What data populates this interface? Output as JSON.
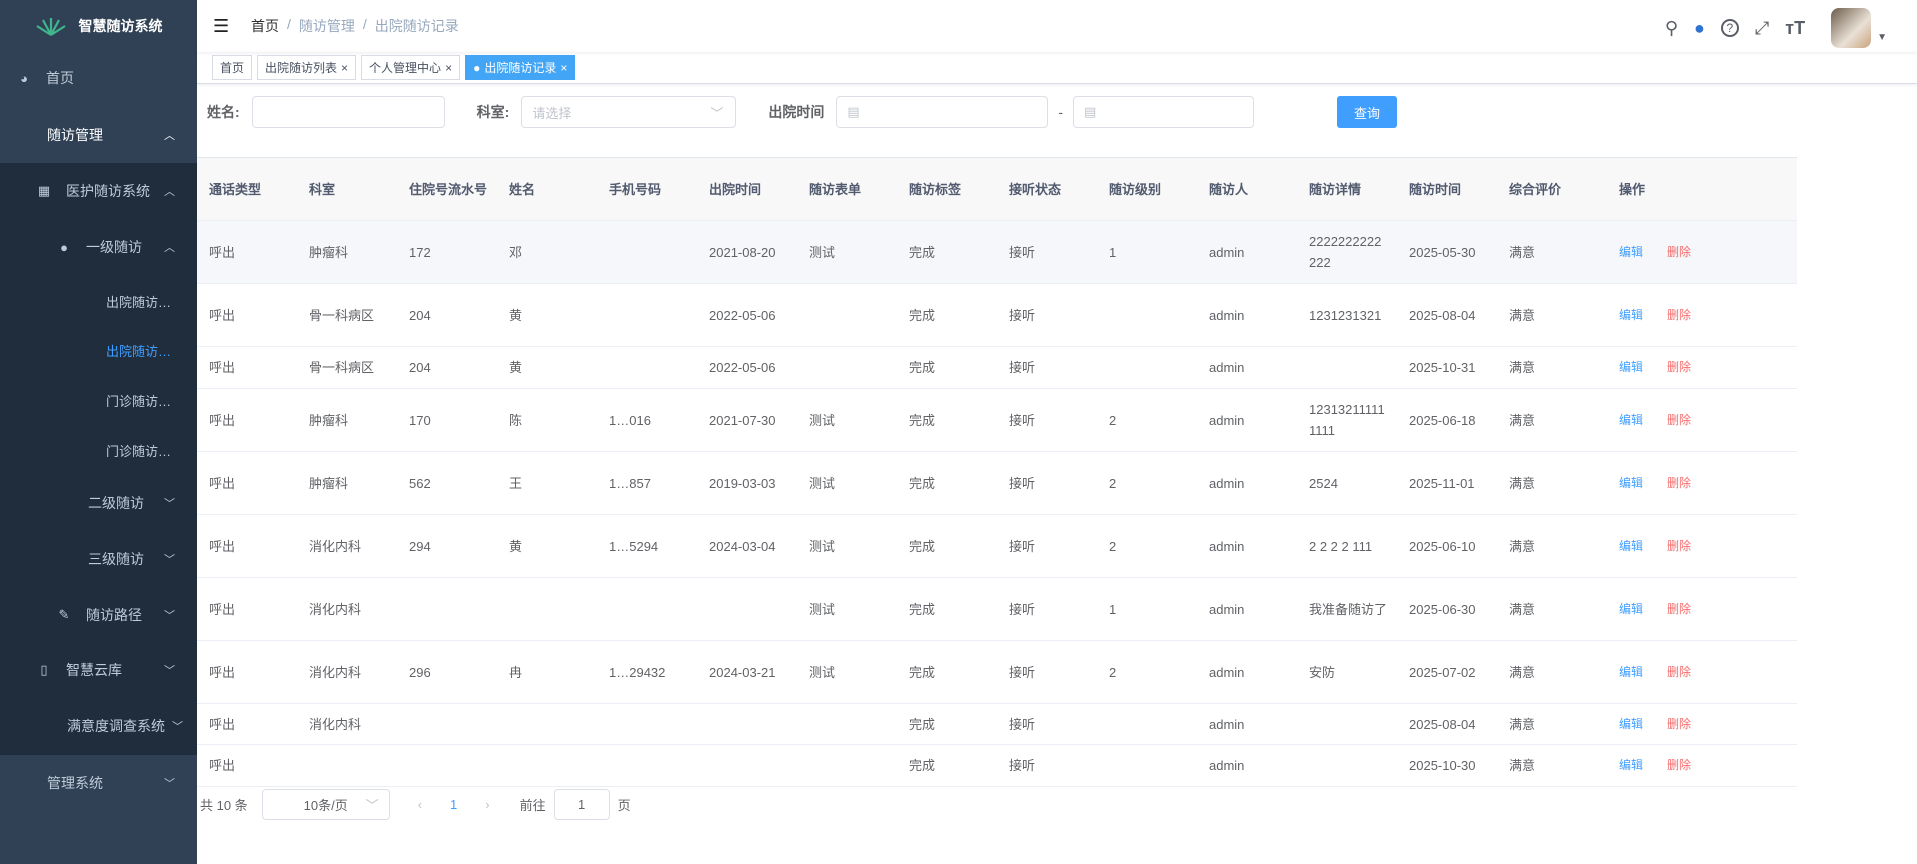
{
  "app": {
    "title": "智慧随访系统"
  },
  "sidebar": {
    "items": [
      {
        "label": "首页",
        "icon": "dashboard-icon"
      },
      {
        "label": "随访管理"
      },
      {
        "label": "医护随访系统",
        "icon": "table-icon"
      },
      {
        "label": "一级随访",
        "icon": "user-icon"
      },
      {
        "label": "出院随访…"
      },
      {
        "label": "出院随访…"
      },
      {
        "label": "门诊随访…"
      },
      {
        "label": "门诊随访…"
      },
      {
        "label": "二级随访"
      },
      {
        "label": "三级随访"
      },
      {
        "label": "随访路径",
        "icon": "edit-icon"
      },
      {
        "label": "智慧云库",
        "icon": "book-icon"
      },
      {
        "label": "满意度调查系统"
      },
      {
        "label": "管理系统"
      }
    ]
  },
  "breadcrumb": [
    "首页",
    "随访管理",
    "出院随访记录"
  ],
  "tags": [
    {
      "label": "首页"
    },
    {
      "label": "出院随访列表"
    },
    {
      "label": "个人管理中心"
    },
    {
      "label": "出院随访记录"
    }
  ],
  "filters": {
    "name_label": "姓名:",
    "name_value": "",
    "dept_label": "科室:",
    "dept_placeholder": "请选择",
    "date_label": "出院时间",
    "date_sep": "-",
    "query": "查询"
  },
  "table": {
    "headers": [
      "通话类型",
      "科室",
      "住院号流水号",
      "姓名",
      "手机号码",
      "出院时间",
      "随访表单",
      "随访标签",
      "接听状态",
      "随访级别",
      "随访人",
      "随访详情",
      "随访时间",
      "综合评价",
      "操作"
    ],
    "edit": "编辑",
    "delete": "删除",
    "rows": [
      [
        "呼出",
        "肿瘤科",
        "172",
        "邓",
        "",
        "2021-08-20",
        "测试",
        "完成",
        "接听",
        "1",
        "admin",
        "2222222222222",
        "2025-05-30",
        "满意"
      ],
      [
        "呼出",
        "骨一科病区",
        "204",
        "黄",
        "",
        "2022-05-06",
        "",
        "完成",
        "接听",
        "",
        "admin",
        "1231231321",
        "2025-08-04",
        "满意"
      ],
      [
        "呼出",
        "骨一科病区",
        "204",
        "黄",
        "",
        "2022-05-06",
        "",
        "完成",
        "接听",
        "",
        "admin",
        "",
        "2025-10-31",
        "满意"
      ],
      [
        "呼出",
        "肿瘤科",
        "170",
        "陈",
        "1…016",
        "2021-07-30",
        "测试",
        "完成",
        "接听",
        "2",
        "admin",
        "123132111111111",
        "2025-06-18",
        "满意"
      ],
      [
        "呼出",
        "肿瘤科",
        "562",
        "王",
        "1…857",
        "2019-03-03",
        "测试",
        "完成",
        "接听",
        "2",
        "admin",
        "2524",
        "2025-11-01",
        "满意"
      ],
      [
        "呼出",
        "消化内科",
        "294",
        "黄",
        "1…5294",
        "2024-03-04",
        "测试",
        "完成",
        "接听",
        "2",
        "admin",
        "2 2 2 2 111",
        "2025-06-10",
        "满意"
      ],
      [
        "呼出",
        "消化内科",
        "",
        "",
        "",
        "",
        "测试",
        "完成",
        "接听",
        "1",
        "admin",
        "我准备随访了",
        "2025-06-30",
        "满意"
      ],
      [
        "呼出",
        "消化内科",
        "296",
        "冉",
        "1…29432",
        "2024-03-21",
        "测试",
        "完成",
        "接听",
        "2",
        "admin",
        "安防",
        "2025-07-02",
        "满意"
      ],
      [
        "呼出",
        "消化内科",
        "",
        "",
        "",
        "",
        "",
        "完成",
        "接听",
        "",
        "admin",
        "",
        "2025-08-04",
        "满意"
      ],
      [
        "呼出",
        "",
        "",
        "",
        "",
        "",
        "",
        "完成",
        "接听",
        "",
        "admin",
        "",
        "2025-10-30",
        "满意"
      ]
    ]
  },
  "pagination": {
    "total": "共 10 条",
    "page_size": "10条/页",
    "current": "1",
    "goto_label": "前往",
    "goto_value": "1",
    "page_suffix": "页"
  },
  "colors": {
    "sidebar": "#304156",
    "submenu": "#1f2d3d",
    "accent": "#409eff",
    "danger": "#f56c6c"
  }
}
